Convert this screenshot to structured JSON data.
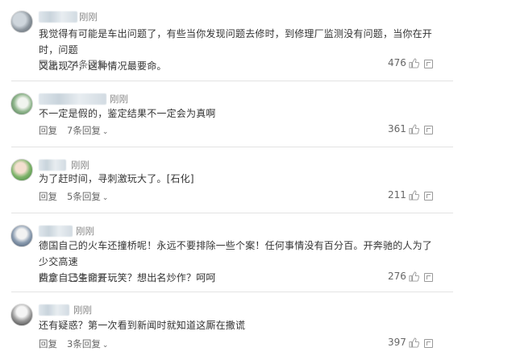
{
  "comments": [
    {
      "time": "刚刚",
      "lines": [
        "我觉得有可能是车出问题了，有些当你发现问题去修时，到修理厂监测没有问题，当你在开时，问题",
        "又出现了，这种情况最要命。"
      ],
      "reply_label": "回复",
      "replies_label": "24条回复",
      "likes": "476"
    },
    {
      "time": "刚刚",
      "lines": [
        "不一定是假的，鉴定结果不一定会为真啊"
      ],
      "reply_label": "回复",
      "replies_label": "7条回复",
      "likes": "361"
    },
    {
      "time": "刚刚",
      "lines": [
        "为了赶时间，寻刺激玩大了。[石化]"
      ],
      "reply_label": "回复",
      "replies_label": "5条回复",
      "likes": "211"
    },
    {
      "time": "刚刚",
      "lines": [
        "德国自己的火车还撞桥呢！永远不要排除一些个案！任何事情没有百分百。开奔驰的人为了少交高速",
        "费拿自己生命开玩笑？想出名炒作？呵呵"
      ],
      "reply_label": "回复",
      "replies_label": "15条回复",
      "likes": "276"
    },
    {
      "time": "刚刚",
      "lines": [
        "还有疑惑？第一次看到新闻时就知道这厮在撒谎"
      ],
      "reply_label": "回复",
      "replies_label": "3条回复",
      "likes": "397"
    }
  ],
  "icons": {
    "chevron": "chevron-down-icon",
    "like": "thumbs-up-icon",
    "report": "report-icon"
  },
  "colors": {
    "text": "#333333",
    "meta": "#888888",
    "action": "#666666",
    "divider": "#e3e3e3"
  }
}
